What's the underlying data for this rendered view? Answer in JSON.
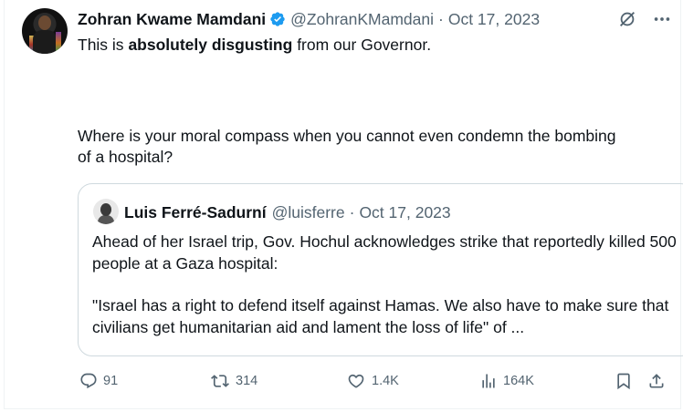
{
  "author": {
    "name": "Zohran Kwame Mamdani",
    "handle": "@ZohranKMamdani",
    "separator": "·",
    "date": "Oct 17, 2023"
  },
  "tweet": {
    "line1_pre": "This is ",
    "line1_bold": "absolutely disgusting",
    "line1_post": " from our Governor.",
    "paragraph2": "Where is your moral compass when you cannot even condemn the bombing of a hospital?"
  },
  "quote": {
    "name": "Luis Ferré-Sadurní",
    "handle": "@luisferre",
    "separator": "·",
    "date": "Oct 17, 2023",
    "paragraph1": "Ahead of her Israel trip, Gov. Hochul acknowledges strike that reportedly killed 500 people at a Gaza hospital:",
    "paragraph2": "\"Israel has a right to defend itself against Hamas. We also have to make sure that civilians get humanitarian aid and lament the loss of life\" of ..."
  },
  "actions": {
    "replies": "91",
    "reposts": "314",
    "likes": "1.4K",
    "views": "164K"
  },
  "colors": {
    "text": "#0f1419",
    "secondary": "#536471",
    "verified": "#1d9bf0",
    "border": "#cfd9de"
  },
  "icons": [
    "verified-badge-icon",
    "grok-icon",
    "more-icon",
    "reply-icon",
    "repost-icon",
    "like-icon",
    "views-icon",
    "bookmark-icon",
    "share-icon"
  ]
}
